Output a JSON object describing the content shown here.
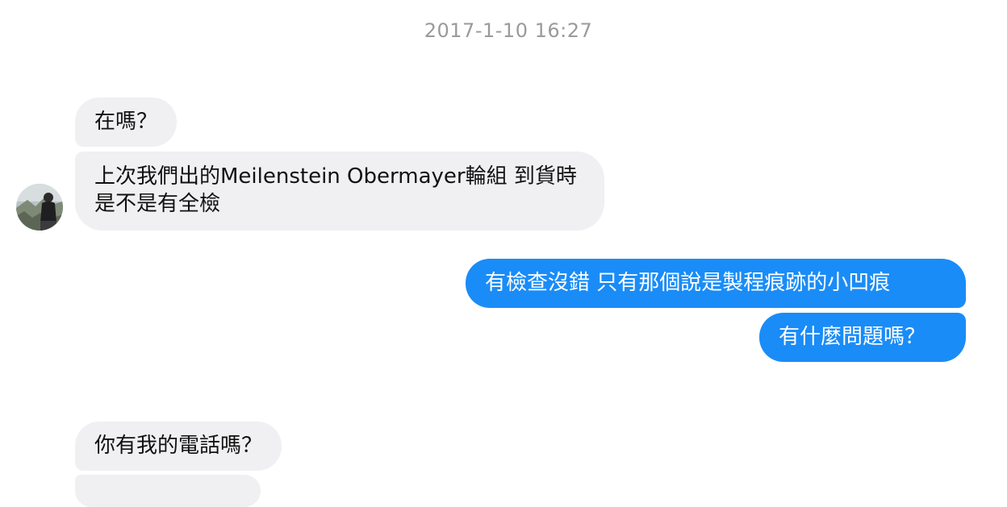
{
  "conversation": {
    "timestamp": "2017-1-10 16:27",
    "messages": [
      {
        "sender": "other",
        "text": "在嗎？"
      },
      {
        "sender": "other",
        "text": "上次我們出的Meilenstein Obermayer輪組 到貨時是不是有全檢"
      },
      {
        "sender": "me",
        "text": "有檢查沒錯 只有那個說是製程痕跡的小凹痕"
      },
      {
        "sender": "me",
        "text": "有什麼問題嗎？"
      },
      {
        "sender": "other",
        "text": "你有我的電話嗎？"
      }
    ]
  },
  "colors": {
    "incoming_bubble": "#f0eff2",
    "outgoing_bubble": "#1a8cf7",
    "timestamp": "#9a9a9e"
  },
  "icons": {
    "avatar": "contact-avatar-photo"
  }
}
